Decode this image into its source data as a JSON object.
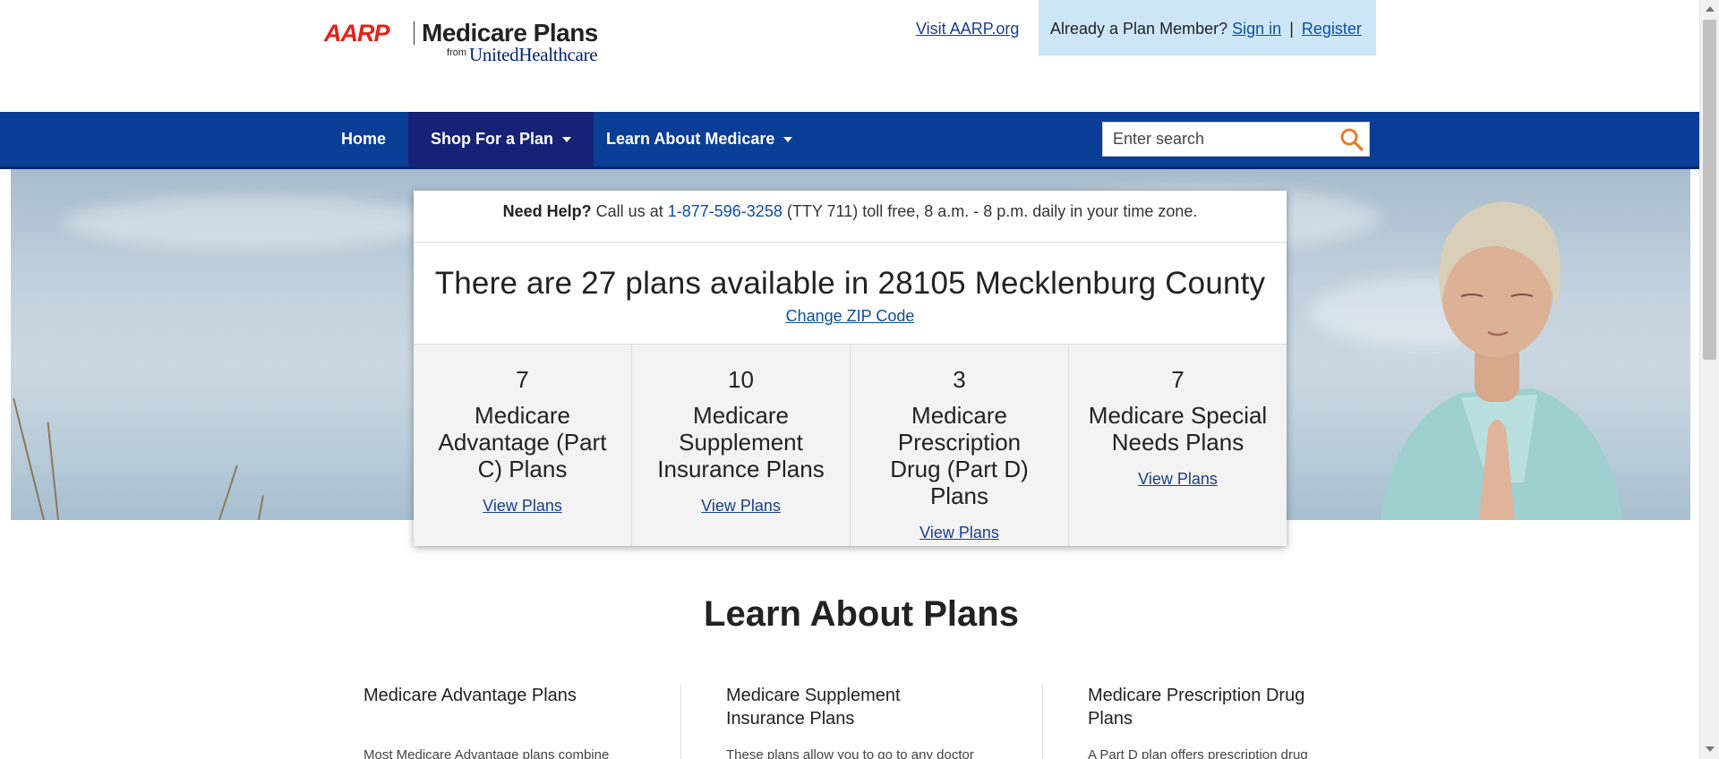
{
  "header": {
    "logo": {
      "brand": "AARP",
      "product": "Medicare Plans",
      "from": "from",
      "partner": "UnitedHealthcare"
    },
    "visit_link": "Visit AARP.org",
    "member_prompt": "Already a Plan Member?",
    "sign_in": "Sign in",
    "separator": "|",
    "register": "Register"
  },
  "nav": {
    "items": [
      {
        "label": "Home"
      },
      {
        "label": "Shop For a Plan"
      },
      {
        "label": "Learn About Medicare"
      }
    ],
    "search_placeholder": "Enter search"
  },
  "help": {
    "lead": "Need Help?",
    "text_before": "Call us at",
    "phone": "1-877-596-3258",
    "text_after": "(TTY 711) toll free, 8 a.m. - 8 p.m. daily in your time zone."
  },
  "availability": {
    "headline": "There are 27 plans available in 28105 Mecklenburg County",
    "change_zip": "Change ZIP Code"
  },
  "plans": [
    {
      "count": "7",
      "name": "Medicare Advantage (Part C) Plans",
      "link": "View Plans"
    },
    {
      "count": "10",
      "name": "Medicare Supplement Insurance Plans",
      "link": "View Plans"
    },
    {
      "count": "3",
      "name": "Medicare Prescription Drug (Part D) Plans",
      "link": "View Plans"
    },
    {
      "count": "7",
      "name": "Medicare Special Needs Plans",
      "link": "View Plans"
    }
  ],
  "learn": {
    "title": "Learn About Plans",
    "columns": [
      {
        "title": "Medicare Advantage Plans",
        "text": "Most Medicare Advantage plans combine"
      },
      {
        "title": "Medicare Supplement Insurance Plans",
        "text": "These plans allow you to go to any doctor"
      },
      {
        "title": "Medicare Prescription Drug Plans",
        "text": "A Part D plan offers prescription drug"
      }
    ]
  },
  "colors": {
    "nav_bg": "#0a3d96",
    "nav_active": "#152276",
    "aarp_red": "#e2231a",
    "link_blue": "#0b4ea2",
    "member_box": "#cce6f8",
    "search_icon": "#e87722"
  },
  "icons": {
    "search": "search-icon",
    "dropdown": "caret-down-icon"
  }
}
